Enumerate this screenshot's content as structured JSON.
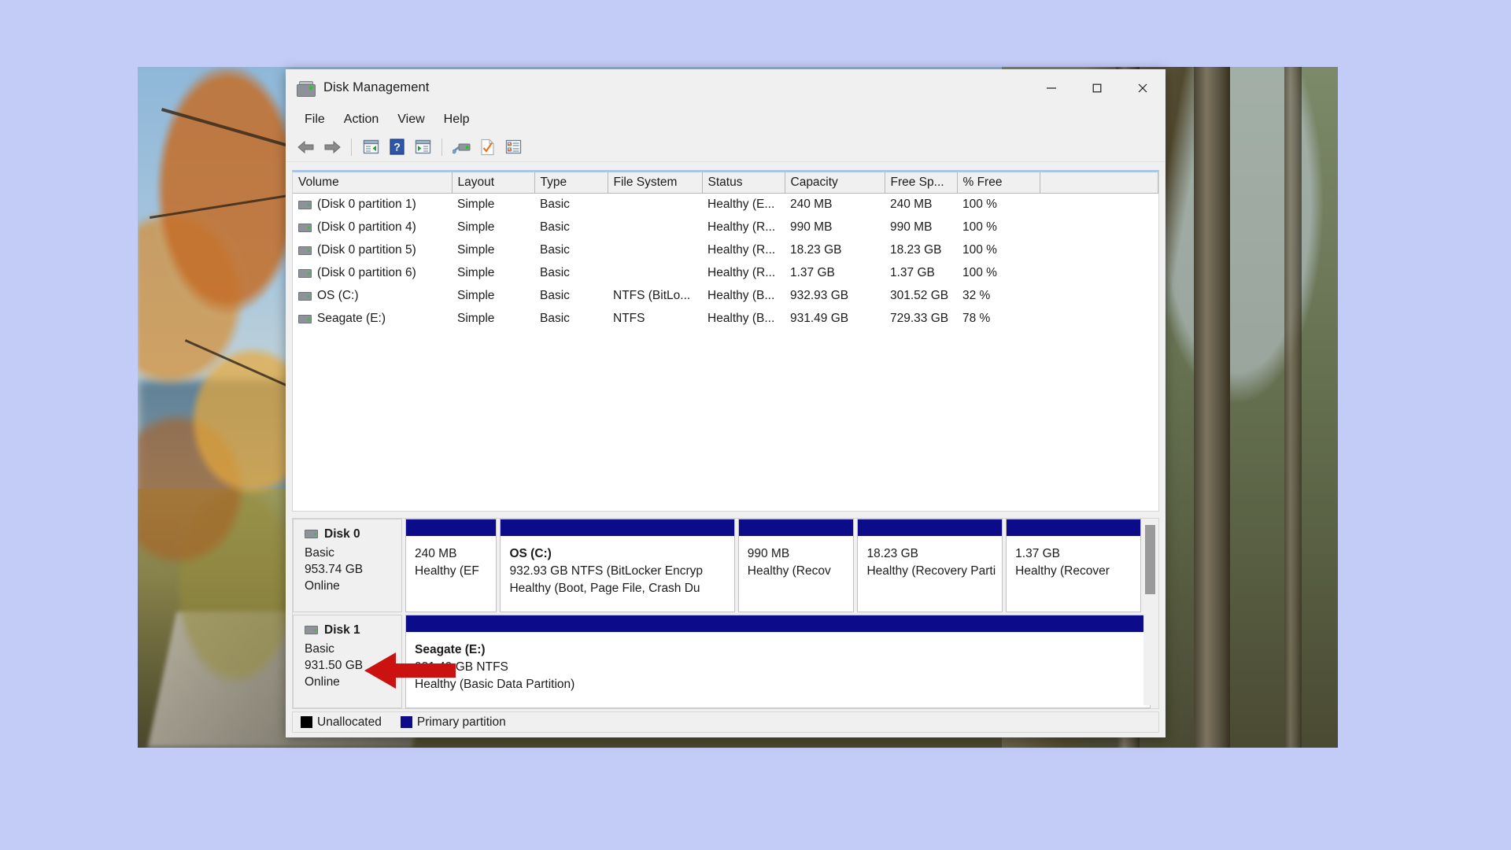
{
  "window": {
    "title": "Disk Management",
    "icon": "disk-management-icon",
    "controls": {
      "minimize": "—",
      "maximize": "□",
      "close": "✕"
    }
  },
  "menubar": {
    "items": [
      "File",
      "Action",
      "View",
      "Help"
    ]
  },
  "toolbar": {
    "items": [
      {
        "name": "back-icon",
        "label": "Back"
      },
      {
        "name": "forward-icon",
        "label": "Forward"
      },
      {
        "name": "separator",
        "label": ""
      },
      {
        "name": "show-hide-console-tree-icon",
        "label": "Show/Hide Console Tree"
      },
      {
        "name": "help-icon",
        "label": "Help"
      },
      {
        "name": "show-hide-action-pane-icon",
        "label": "Show/Hide Action Pane"
      },
      {
        "name": "separator",
        "label": ""
      },
      {
        "name": "rescan-disks-icon",
        "label": "Rescan Disks"
      },
      {
        "name": "properties-icon",
        "label": "Properties"
      },
      {
        "name": "list-view-icon",
        "label": "List View"
      }
    ]
  },
  "volume_list": {
    "columns": [
      "Volume",
      "Layout",
      "Type",
      "File System",
      "Status",
      "Capacity",
      "Free Sp...",
      "% Free",
      ""
    ],
    "rows": [
      {
        "volume": "(Disk 0 partition 1)",
        "layout": "Simple",
        "type": "Basic",
        "fs": "",
        "status": "Healthy (E...",
        "capacity": "240 MB",
        "free": "240 MB",
        "pct": "100 %"
      },
      {
        "volume": "(Disk 0 partition 4)",
        "layout": "Simple",
        "type": "Basic",
        "fs": "",
        "status": "Healthy (R...",
        "capacity": "990 MB",
        "free": "990 MB",
        "pct": "100 %"
      },
      {
        "volume": "(Disk 0 partition 5)",
        "layout": "Simple",
        "type": "Basic",
        "fs": "",
        "status": "Healthy (R...",
        "capacity": "18.23 GB",
        "free": "18.23 GB",
        "pct": "100 %"
      },
      {
        "volume": "(Disk 0 partition 6)",
        "layout": "Simple",
        "type": "Basic",
        "fs": "",
        "status": "Healthy (R...",
        "capacity": "1.37 GB",
        "free": "1.37 GB",
        "pct": "100 %"
      },
      {
        "volume": "OS (C:)",
        "layout": "Simple",
        "type": "Basic",
        "fs": "NTFS (BitLo...",
        "status": "Healthy (B...",
        "capacity": "932.93 GB",
        "free": "301.52 GB",
        "pct": "32 %"
      },
      {
        "volume": "Seagate (E:)",
        "layout": "Simple",
        "type": "Basic",
        "fs": "NTFS",
        "status": "Healthy (B...",
        "capacity": "931.49 GB",
        "free": "729.33 GB",
        "pct": "78 %"
      }
    ]
  },
  "graphical_view": {
    "disks": [
      {
        "name": "Disk 0",
        "type": "Basic",
        "size": "953.74 GB",
        "state": "Online",
        "partitions": [
          {
            "name": "",
            "size_fs": "240 MB",
            "status": "Healthy (EF",
            "width_pct": 12.3
          },
          {
            "name": "OS  (C:)",
            "size_fs": "932.93 GB NTFS (BitLocker Encryp",
            "status": "Healthy (Boot, Page File, Crash Du",
            "width_pct": 31.5
          },
          {
            "name": "",
            "size_fs": "990 MB",
            "status": "Healthy (Recov",
            "width_pct": 15.6
          },
          {
            "name": "",
            "size_fs": "18.23 GB",
            "status": "Healthy (Recovery Parti",
            "width_pct": 19.5
          },
          {
            "name": "",
            "size_fs": "1.37 GB",
            "status": "Healthy (Recover",
            "width_pct": 18.2
          }
        ]
      },
      {
        "name": "Disk 1",
        "type": "Basic",
        "size": "931.50 GB",
        "state": "Online",
        "partitions": [
          {
            "name": "Seagate  (E:)",
            "size_fs": "931.49 GB NTFS",
            "status": "Healthy (Basic Data Partition)",
            "width_pct": 100
          }
        ]
      }
    ]
  },
  "legend": {
    "items": [
      {
        "label": "Unallocated",
        "color": "#000000",
        "swatch": "sw-unalloc"
      },
      {
        "label": "Primary partition",
        "color": "#0c0c8a",
        "swatch": "sw-primary"
      }
    ]
  },
  "annotation": {
    "arrow_color": "#cc1111",
    "points_to": "Disk 1 Online status"
  },
  "colors": {
    "primary_partition": "#0c0c8a",
    "unallocated": "#000000",
    "window_chrome": "#f0f0f0",
    "desktop_background": "#c3cbf7"
  }
}
